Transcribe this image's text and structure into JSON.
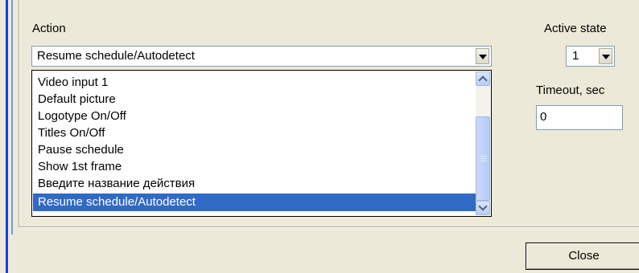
{
  "action": {
    "label": "Action",
    "selected": "Resume schedule/Autodetect",
    "options": [
      "Video input 1",
      "Default picture",
      "Logotype On/Off",
      "Titles On/Off",
      "Pause schedule",
      "Show 1st frame",
      "Введите название действия",
      "Resume schedule/Autodetect"
    ]
  },
  "active_state": {
    "label": "Active state",
    "value": "1"
  },
  "timeout": {
    "label": "Timeout, sec",
    "value": "0"
  },
  "buttons": {
    "close": "Close"
  },
  "icons": {
    "dropdown": "chevron-down-icon",
    "scroll_up": "scroll-up-icon",
    "scroll_down": "scroll-down-icon"
  },
  "colors": {
    "selection": "#316ac5",
    "dialog_bg": "#ece9d8",
    "window_frame": "#1c3ccf"
  }
}
